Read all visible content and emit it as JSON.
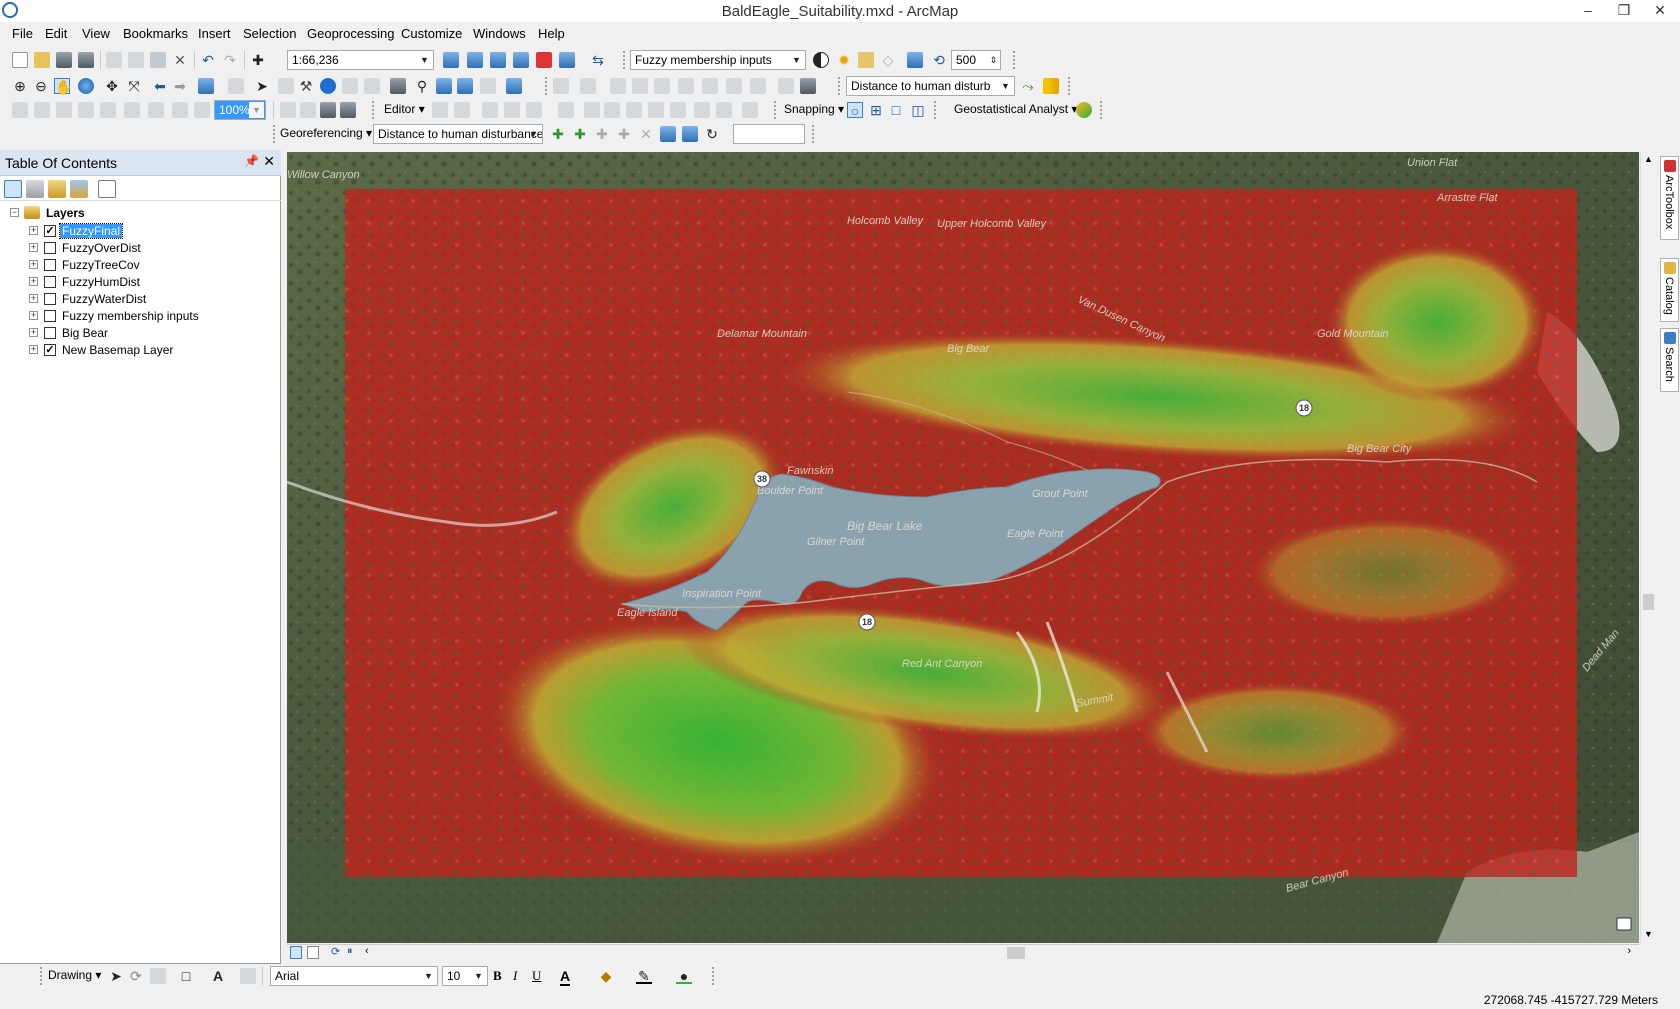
{
  "window": {
    "title": "BaldEagle_Suitability.mxd - ArcMap"
  },
  "menu": [
    "File",
    "Edit",
    "View",
    "Bookmarks",
    "Insert",
    "Selection",
    "Geoprocessing",
    "Customize",
    "Windows",
    "Help"
  ],
  "standard_toolbar": {
    "scale": "1:66,236",
    "layer_combo": "Fuzzy membership inputs",
    "cache_value": "500"
  },
  "tools_toolbar": {
    "raster_layer_combo": "Distance to human disturb"
  },
  "editor_toolbar": {
    "zoom_percent": "100%",
    "editor_label": "Editor",
    "snapping_label": "Snapping",
    "geostat_label": "Geostatistical Analyst"
  },
  "georef_toolbar": {
    "label": "Georeferencing",
    "layer_combo": "Distance to human disturbance",
    "rms_value": ""
  },
  "toc": {
    "title": "Table Of Contents",
    "root": "Layers",
    "layers": [
      {
        "name": "FuzzyFinal",
        "checked": true,
        "selected": true
      },
      {
        "name": "FuzzyOverDist",
        "checked": false,
        "selected": false
      },
      {
        "name": "FuzzyTreeCov",
        "checked": false,
        "selected": false
      },
      {
        "name": "FuzzyHumDist",
        "checked": false,
        "selected": false
      },
      {
        "name": "FuzzyWaterDist",
        "checked": false,
        "selected": false
      },
      {
        "name": "Fuzzy membership inputs",
        "checked": false,
        "selected": false
      },
      {
        "name": "Big Bear",
        "checked": false,
        "selected": false
      },
      {
        "name": "New Basemap Layer",
        "checked": true,
        "selected": false
      }
    ]
  },
  "map_labels": [
    "Willow Canyon",
    "Upper Holcomb Valley",
    "Holcomb Valley",
    "Union Flat",
    "Arrastre Flat",
    "Delamar Mountain",
    "Big Bear",
    "Big Bear City",
    "Fawnskin",
    "Big Bear Lake",
    "Grout Point",
    "Gilner Point",
    "Eagle Point",
    "Boulder Point",
    "Inspiration Point",
    "Eagle Island",
    "Gold Mountain",
    "Van Dusen Canyon",
    "Red Ant Canyon",
    "Summit",
    "Bear Canyon",
    "Dead Man"
  ],
  "road_shields": [
    "38",
    "18",
    "18"
  ],
  "side_tabs": [
    "ArcToolbox",
    "Catalog",
    "Search"
  ],
  "drawing_toolbar": {
    "label": "Drawing",
    "font": "Arial",
    "size": "10",
    "bold": "B",
    "italic": "I",
    "underline": "U",
    "font_color_glyph": "A"
  },
  "status": {
    "coordinates": "272068.745  -415727.729 Meters"
  },
  "colors": {
    "toc_header": "#dbe5f1",
    "selection": "#3399ff",
    "suitability_low": "#c0241c",
    "suitability_mid": "#e2c532",
    "suitability_high": "#3cc43a",
    "lake": "#8aa2ad"
  }
}
